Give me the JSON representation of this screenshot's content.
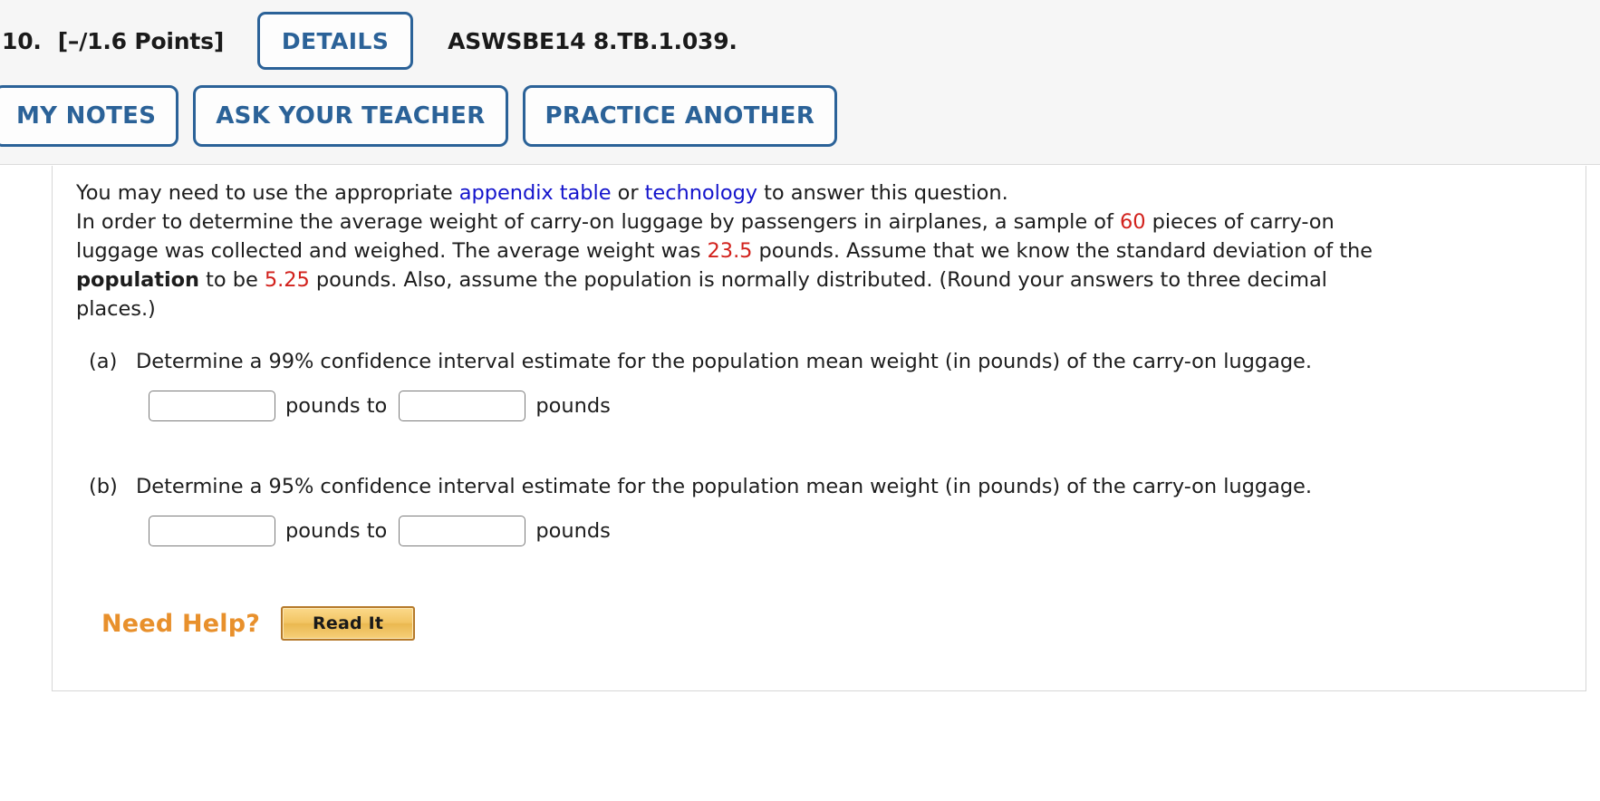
{
  "header": {
    "question_number": "10.",
    "points": "[–/1.6 Points]",
    "details_label": "DETAILS",
    "question_code": "ASWSBE14 8.TB.1.039.",
    "buttons": [
      {
        "label": "MY NOTES",
        "name": "my-notes-button"
      },
      {
        "label": "ASK YOUR TEACHER",
        "name": "ask-your-teacher-button"
      },
      {
        "label": "PRACTICE ANOTHER",
        "name": "practice-another-button"
      }
    ]
  },
  "content": {
    "intro": {
      "before_link1": "You may need to use the appropriate ",
      "link1": "appendix table",
      "between_links": " or ",
      "link2": "technology",
      "after_link2": " to answer this question."
    },
    "problem": {
      "seg1": "In order to determine the average weight of carry-on luggage by passengers in airplanes, a sample of ",
      "sample_size": "60",
      "seg2": " pieces of carry-on luggage was collected and weighed. The average weight was ",
      "average_weight": "23.5",
      "seg3": " pounds. Assume that we know the standard deviation of the ",
      "bold_word": "population",
      "seg4": " to be ",
      "std_dev": "5.25",
      "seg5": " pounds. Also, assume the population is normally distributed. (Round your answers to three decimal places.)"
    },
    "parts": [
      {
        "label": "(a)",
        "text": "Determine a 99% confidence interval estimate for the population mean weight (in pounds) of the carry-on luggage.",
        "lower_value": "",
        "upper_value": "",
        "unit_mid": "pounds to",
        "unit_end": "pounds"
      },
      {
        "label": "(b)",
        "text": "Determine a 95% confidence interval estimate for the population mean weight (in pounds) of the carry-on luggage.",
        "lower_value": "",
        "upper_value": "",
        "unit_mid": "pounds to",
        "unit_end": "pounds"
      }
    ],
    "need_help": {
      "label": "Need Help?",
      "read_it_label": "Read It"
    }
  },
  "colors": {
    "link_blue": "#1414cc",
    "value_red": "#d2211c",
    "button_blue": "#2b6298",
    "need_help_orange": "#e8902c",
    "read_it_gold": "#f2c462"
  }
}
